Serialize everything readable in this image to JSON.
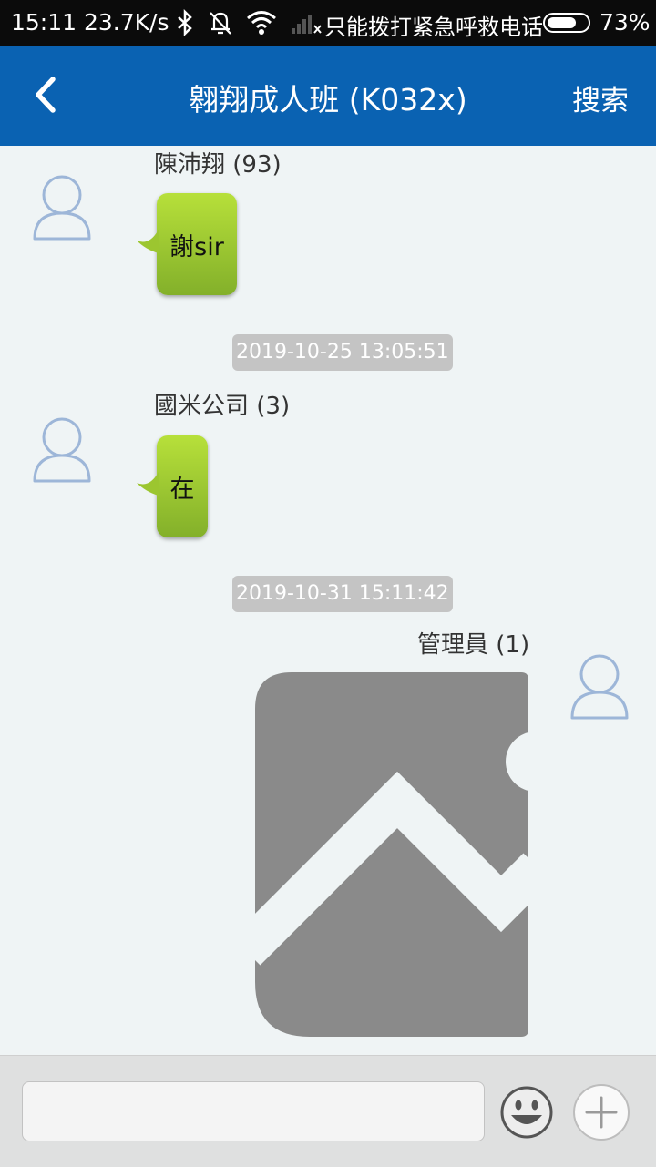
{
  "status_bar": {
    "time": "15:11",
    "speed": "23.7K/s",
    "carrier": "只能拨打紧急呼救电话",
    "battery_percent": "73%",
    "battery_level": 0.73,
    "icons": [
      "bluetooth-icon",
      "bell-muted-icon",
      "wifi-icon",
      "signal-icon"
    ]
  },
  "header": {
    "title": "翱翔成人班 (K032x)",
    "search_label": "搜索",
    "back_icon": "chevron-left-icon"
  },
  "messages": [
    {
      "sender": "陳沛翔 (93)",
      "text": "謝sir"
    },
    {
      "timestamp": "2019-10-25 13:05:51"
    },
    {
      "sender": "國米公司 (3)",
      "text": "在"
    },
    {
      "timestamp": "2019-10-31 15:11:42"
    },
    {
      "sender": "管理員 (1)",
      "image": "image-placeholder-icon"
    }
  ],
  "input_bar": {
    "value": "",
    "placeholder": "",
    "emoji_icon": "emoji-smile-icon",
    "plus_icon": "plus-icon"
  },
  "colors": {
    "header_bg": "#0a62b2",
    "chat_bg": "#eff4f5",
    "bubble_green": "#a4cc35",
    "timestamp_bg": "#c4c4c4",
    "image_gray": "#8a8a8a"
  }
}
